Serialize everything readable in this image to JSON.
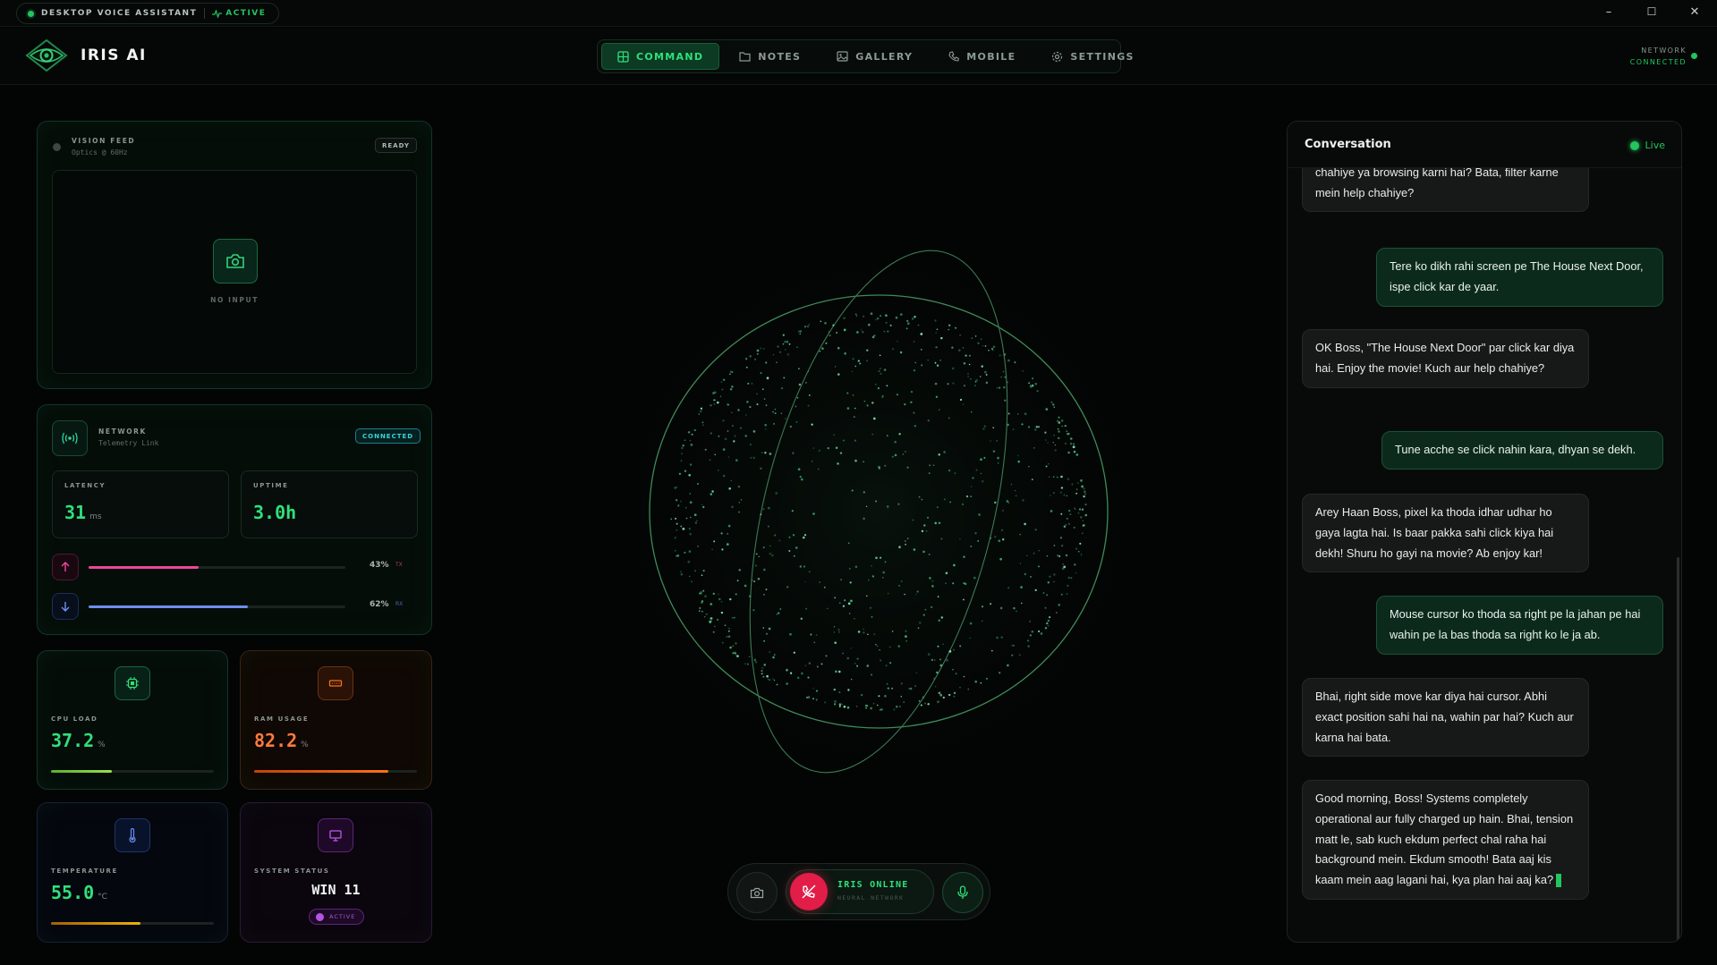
{
  "titlebar": {
    "app_name": "DESKTOP VOICE ASSISTANT",
    "status": "ACTIVE",
    "minimize": "–",
    "maximize": "☐",
    "close": "✕"
  },
  "header": {
    "title": "IRIS AI",
    "network_label": "NETWORK",
    "network_status": "CONNECTED",
    "tabs": [
      {
        "label": "COMMAND",
        "icon": "grid-icon",
        "active": true
      },
      {
        "label": "NOTES",
        "icon": "folder-icon",
        "active": false
      },
      {
        "label": "GALLERY",
        "icon": "image-icon",
        "active": false
      },
      {
        "label": "MOBILE",
        "icon": "phone-icon",
        "active": false
      },
      {
        "label": "SETTINGS",
        "icon": "gear-icon",
        "active": false
      }
    ]
  },
  "vision": {
    "title": "VISION FEED",
    "subtitle": "Optics @ 60Hz",
    "badge": "READY",
    "placeholder": "NO INPUT"
  },
  "network": {
    "title": "NETWORK",
    "subtitle": "Telemetry Link",
    "badge": "CONNECTED",
    "latency_label": "LATENCY",
    "latency_value": "31",
    "latency_unit": "ms",
    "uptime_label": "UPTIME",
    "uptime_value": "3.0h",
    "tx_percent": "43%",
    "tx_label": "TX",
    "tx_fraction": 0.43,
    "rx_percent": "62%",
    "rx_label": "RX",
    "rx_fraction": 0.62
  },
  "cpu": {
    "label": "CPU LOAD",
    "value": "37.2",
    "unit": "%",
    "fraction": 0.372
  },
  "ram": {
    "label": "RAM USAGE",
    "value": "82.2",
    "unit": "%",
    "fraction": 0.822
  },
  "temperature": {
    "label": "TEMPERATURE",
    "value": "55.0",
    "unit": "°C",
    "fraction": 0.55
  },
  "system": {
    "label": "SYSTEM STATUS",
    "value": "WIN 11",
    "badge": "ACTIVE"
  },
  "conversation": {
    "title": "Conversation",
    "live": "Live",
    "messages": [
      {
        "role": "ai",
        "text": "liye. Wahan pe search kar le, koi specific movie chahiye ya browsing karni hai? Bata, filter karne mein help chahiye?"
      },
      {
        "role": "user",
        "text": "Tere ko dikh rahi screen pe The House Next Door, ispe click kar de yaar."
      },
      {
        "role": "ai",
        "text": "OK Boss, \"The House Next Door\" par click kar diya hai. Enjoy the movie! Kuch aur help chahiye?"
      },
      {
        "role": "user",
        "text": "Tune acche se click nahin kara, dhyan se dekh."
      },
      {
        "role": "ai",
        "text": "Arey Haan Boss, pixel ka thoda idhar udhar ho gaya lagta hai. Is baar pakka sahi click kiya hai dekh! Shuru ho gayi na movie? Ab enjoy kar!"
      },
      {
        "role": "user",
        "text": "Mouse cursor ko thoda sa right pe la jahan pe hai wahin pe la bas thoda sa right ko le ja ab."
      },
      {
        "role": "ai",
        "text": "Bhai, right side move kar diya hai cursor. Abhi exact position sahi hai na, wahin par hai? Kuch aur karna hai bata."
      },
      {
        "role": "ai",
        "text": "Good morning, Boss! Systems completely operational aur fully charged up hain. Bhai, tension matt le, sab kuch ekdum perfect chal raha hai background mein. Ekdum smooth! Bata aaj kis kaam mein aag lagani hai, kya plan hai aaj ka?"
      }
    ]
  },
  "controls": {
    "status": "IRIS ONLINE",
    "substatus": "NEURAL NETWORK"
  },
  "colors": {
    "accent": "#22c55e",
    "tx": "#ec4899",
    "rx": "#6d8ff0",
    "ram": "#f97316",
    "hangup": "#e11d48"
  }
}
